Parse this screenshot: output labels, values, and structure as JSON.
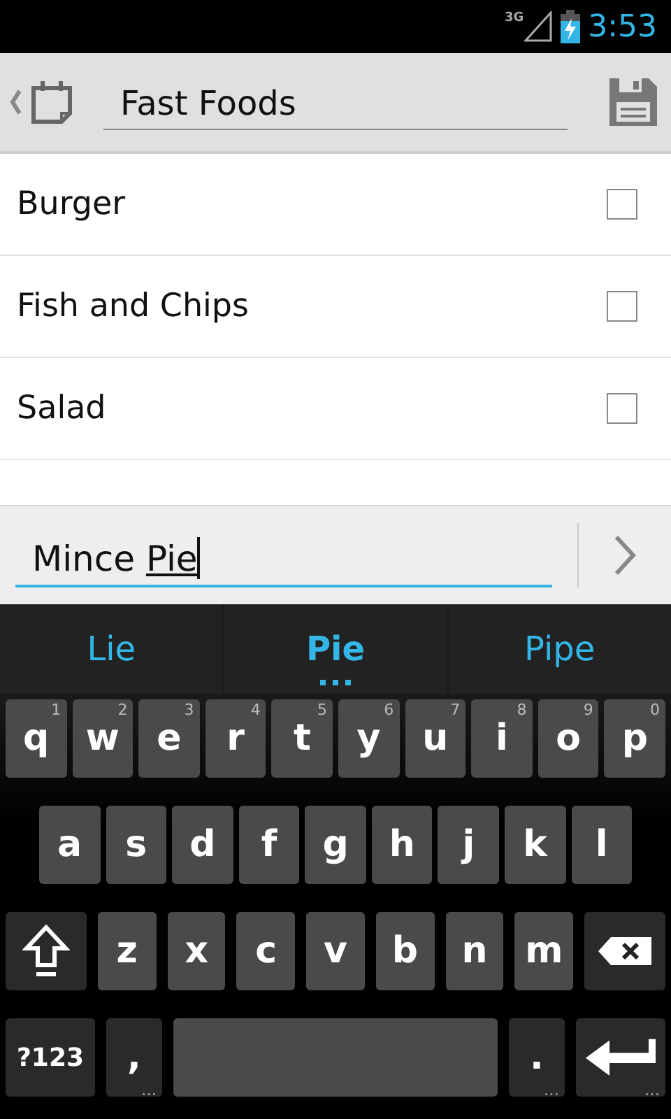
{
  "status_bar": {
    "network": "3G",
    "time": "3:53"
  },
  "action_bar": {
    "title": "Fast Foods"
  },
  "items": [
    {
      "label": "Burger",
      "checked": false
    },
    {
      "label": "Fish and Chips",
      "checked": false
    },
    {
      "label": "Salad",
      "checked": false
    }
  ],
  "input": {
    "text": "Mince ",
    "composing": "Pie"
  },
  "suggestions": [
    {
      "label": "Lie",
      "selected": false
    },
    {
      "label": "Pie",
      "selected": true
    },
    {
      "label": "Pipe",
      "selected": false
    }
  ],
  "keyboard": [
    [
      {
        "kind": "letter",
        "label": "q",
        "hint": "1"
      },
      {
        "kind": "letter",
        "label": "w",
        "hint": "2"
      },
      {
        "kind": "letter",
        "label": "e",
        "hint": "3"
      },
      {
        "kind": "letter",
        "label": "r",
        "hint": "4"
      },
      {
        "kind": "letter",
        "label": "t",
        "hint": "5"
      },
      {
        "kind": "letter",
        "label": "y",
        "hint": "6"
      },
      {
        "kind": "letter",
        "label": "u",
        "hint": "7"
      },
      {
        "kind": "letter",
        "label": "i",
        "hint": "8"
      },
      {
        "kind": "letter",
        "label": "o",
        "hint": "9"
      },
      {
        "kind": "letter",
        "label": "p",
        "hint": "0"
      }
    ],
    [
      {
        "kind": "letter",
        "label": "a"
      },
      {
        "kind": "letter",
        "label": "s"
      },
      {
        "kind": "letter",
        "label": "d"
      },
      {
        "kind": "letter",
        "label": "f"
      },
      {
        "kind": "letter",
        "label": "g"
      },
      {
        "kind": "letter",
        "label": "h"
      },
      {
        "kind": "letter",
        "label": "j"
      },
      {
        "kind": "letter",
        "label": "k"
      },
      {
        "kind": "letter",
        "label": "l"
      }
    ],
    [
      {
        "kind": "shift"
      },
      {
        "kind": "letter",
        "label": "z"
      },
      {
        "kind": "letter",
        "label": "x"
      },
      {
        "kind": "letter",
        "label": "c"
      },
      {
        "kind": "letter",
        "label": "v"
      },
      {
        "kind": "letter",
        "label": "b"
      },
      {
        "kind": "letter",
        "label": "n"
      },
      {
        "kind": "letter",
        "label": "m"
      },
      {
        "kind": "backspace"
      }
    ],
    [
      {
        "kind": "symbols",
        "label": "?123"
      },
      {
        "kind": "punct",
        "label": ",",
        "hint": "…"
      },
      {
        "kind": "space"
      },
      {
        "kind": "punct",
        "label": ".",
        "hint": "…"
      },
      {
        "kind": "enter",
        "hint": "…"
      }
    ]
  ]
}
